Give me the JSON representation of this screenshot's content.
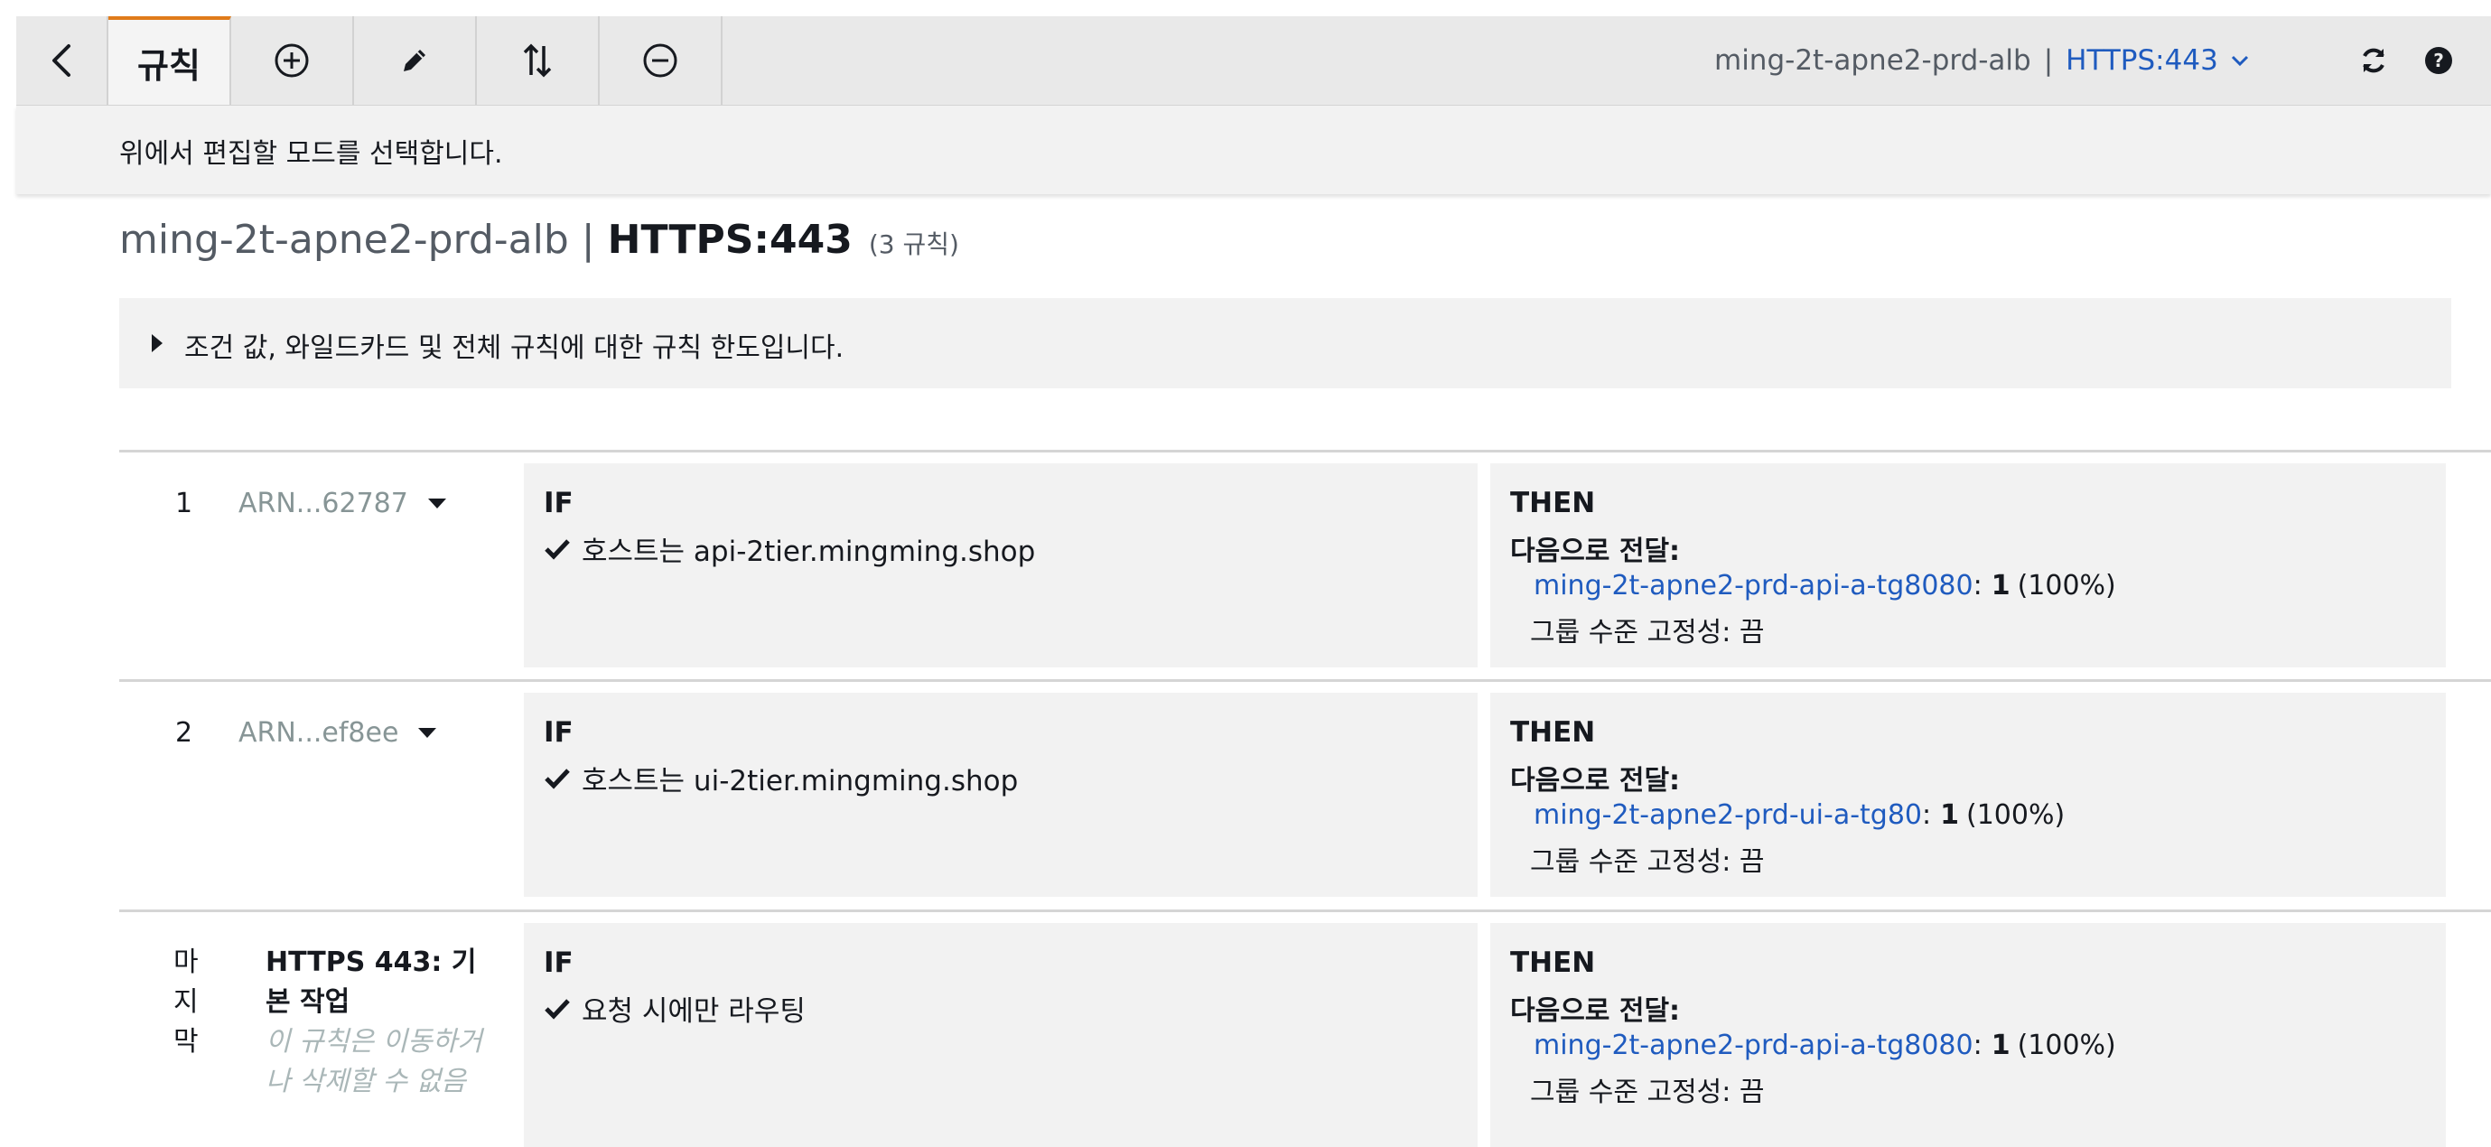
{
  "toolbar": {
    "tabs": [
      {
        "label": "규칙",
        "active": true
      }
    ],
    "buttons": [
      {
        "icon": "chevron-left-icon"
      },
      {
        "icon": "plus-circle-icon"
      },
      {
        "icon": "pencil-icon"
      },
      {
        "icon": "sort-icon"
      },
      {
        "icon": "minus-circle-icon"
      }
    ],
    "lb_name": "ming-2t-apne2-prd-alb",
    "separator": "|",
    "listener": "HTTPS:443",
    "right_icons": [
      "refresh-icon",
      "help-icon"
    ]
  },
  "hint": "위에서 편집할 모드를 선택합니다.",
  "heading": {
    "lb_name": "ming-2t-apne2-prd-alb",
    "separator": "|",
    "listener": "HTTPS:443",
    "count": "(3 규칙)"
  },
  "info": "조건 값, 와일드카드 및 전체 규칙에 대한 규칙 한도입니다.",
  "labels": {
    "if": "IF",
    "then": "THEN",
    "forward": "다음으로 전달:"
  },
  "rules": [
    {
      "number": "1",
      "arn": "ARN...62787",
      "condition": "호스트는 api-2tier.mingming.shop",
      "target_group": "ming-2t-apne2-prd-api-a-tg8080",
      "weight": "1",
      "percent": "(100%)",
      "stickiness": "그룹 수준 고정성: 끔"
    },
    {
      "number": "2",
      "arn": "ARN...ef8ee",
      "condition": "호스트는 ui-2tier.mingming.shop",
      "target_group": "ming-2t-apne2-prd-ui-a-tg80",
      "weight": "1",
      "percent": "(100%)",
      "stickiness": "그룹 수준 고정성: 끔"
    }
  ],
  "default_rule": {
    "label": "마지막",
    "title": "HTTPS 443: 기본 작업",
    "note": "이 규칙은 이동하거나 삭제할 수 없음",
    "condition": "요청 시에만 라우팅",
    "target_group": "ming-2t-apne2-prd-api-a-tg8080",
    "weight": "1",
    "percent": "(100%)",
    "stickiness": "그룹 수준 고정성: 끔"
  },
  "colors": {
    "accent_tab": "#e07b1a",
    "link": "#1f5bbf",
    "panel_bg": "#f2f2f2"
  }
}
